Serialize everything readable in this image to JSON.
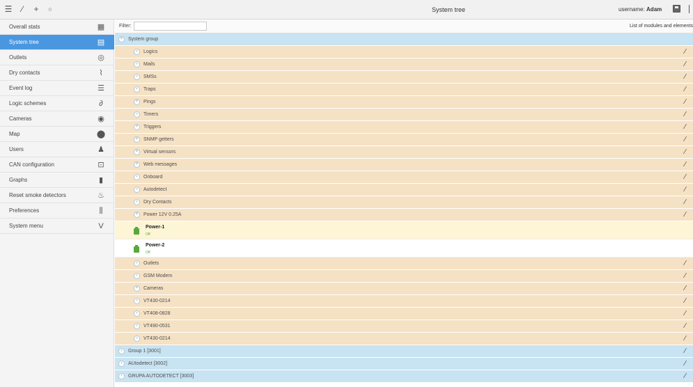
{
  "topbar": {
    "title": "System tree",
    "username_label": "username:",
    "username": "Adam",
    "icons": [
      "menu-icon",
      "wand-icon",
      "plus-icon",
      "refresh-icon",
      "save-icon"
    ]
  },
  "sidebar": {
    "items": [
      {
        "label": "Overall stats",
        "icon": "grid-icon",
        "glyph": "▦",
        "active": false
      },
      {
        "label": "System tree",
        "icon": "tree-icon",
        "glyph": "▤",
        "active": true
      },
      {
        "label": "Outlets",
        "icon": "outlet-icon",
        "glyph": "◎",
        "active": false
      },
      {
        "label": "Dry contacts",
        "icon": "switch-icon",
        "glyph": "⌇",
        "active": false
      },
      {
        "label": "Event log",
        "icon": "list-icon",
        "glyph": "☰",
        "active": false
      },
      {
        "label": "Logic schemes",
        "icon": "link-icon",
        "glyph": "∂",
        "active": false
      },
      {
        "label": "Cameras",
        "icon": "eye-icon",
        "glyph": "◉",
        "active": false
      },
      {
        "label": "Map",
        "icon": "map-pin-icon",
        "glyph": "⬤",
        "active": false
      },
      {
        "label": "Users",
        "icon": "users-icon",
        "glyph": "♟",
        "active": false
      },
      {
        "label": "CAN configuration",
        "icon": "can-icon",
        "glyph": "⊡",
        "active": false
      },
      {
        "label": "Graphs",
        "icon": "bar-chart-icon",
        "glyph": "▮",
        "active": false
      },
      {
        "label": "Reset smoke detectors",
        "icon": "flame-icon",
        "glyph": "♨",
        "active": false
      },
      {
        "label": "Preferences",
        "icon": "sliders-icon",
        "glyph": "⫼",
        "active": false
      },
      {
        "label": "System menu",
        "icon": "v-icon",
        "glyph": "V",
        "active": false
      }
    ]
  },
  "filter": {
    "label": "Filter:",
    "value": "",
    "list_label": "List of modules and elements"
  },
  "tree": {
    "rows": [
      {
        "kind": "group",
        "label": "System group",
        "toggle": "v",
        "color": "blue",
        "indent": 1,
        "edit": false
      },
      {
        "kind": "group",
        "label": "Logics",
        "toggle": ">",
        "color": "tan",
        "indent": 2,
        "edit": true
      },
      {
        "kind": "group",
        "label": "Mails",
        "toggle": ">",
        "color": "tan",
        "indent": 2,
        "edit": true
      },
      {
        "kind": "group",
        "label": "SMSs",
        "toggle": ">",
        "color": "tan",
        "indent": 2,
        "edit": true
      },
      {
        "kind": "group",
        "label": "Traps",
        "toggle": ">",
        "color": "tan",
        "indent": 2,
        "edit": true
      },
      {
        "kind": "group",
        "label": "Pings",
        "toggle": "v",
        "color": "tan",
        "indent": 2,
        "edit": true
      },
      {
        "kind": "group",
        "label": "Timers",
        "toggle": ">",
        "color": "tan",
        "indent": 2,
        "edit": true
      },
      {
        "kind": "group",
        "label": "Triggers",
        "toggle": "v",
        "color": "tan",
        "indent": 2,
        "edit": true
      },
      {
        "kind": "group",
        "label": "SNMP getters",
        "toggle": "v",
        "color": "tan",
        "indent": 2,
        "edit": true
      },
      {
        "kind": "group",
        "label": "Virtual sensors",
        "toggle": "v",
        "color": "tan",
        "indent": 2,
        "edit": true
      },
      {
        "kind": "group",
        "label": "Web messages",
        "toggle": "v",
        "color": "tan",
        "indent": 2,
        "edit": true
      },
      {
        "kind": "group",
        "label": "Onboard",
        "toggle": ">",
        "color": "tan",
        "indent": 2,
        "edit": true
      },
      {
        "kind": "group",
        "label": "Autodetect",
        "toggle": ">",
        "color": "tan",
        "indent": 2,
        "edit": true
      },
      {
        "kind": "group",
        "label": "Dry Contacts",
        "toggle": ">",
        "color": "tan",
        "indent": 2,
        "edit": true
      },
      {
        "kind": "group",
        "label": "Power 12V 0.25A",
        "toggle": "v",
        "color": "tan",
        "indent": 2,
        "edit": true
      },
      {
        "kind": "element",
        "label": "Power-1",
        "state": "Off",
        "color": "yellow"
      },
      {
        "kind": "element",
        "label": "Power-2",
        "state": "Off",
        "color": "white"
      },
      {
        "kind": "group",
        "label": "Outlets",
        "toggle": ">",
        "color": "tan",
        "indent": 2,
        "edit": true
      },
      {
        "kind": "group",
        "label": "GSM Modem",
        "toggle": ">",
        "color": "tan",
        "indent": 2,
        "edit": true
      },
      {
        "kind": "group",
        "label": "Cameras",
        "toggle": "v",
        "color": "tan",
        "indent": 2,
        "edit": true
      },
      {
        "kind": "group",
        "label": "VT430-0214",
        "toggle": ">",
        "color": "tan",
        "indent": 2,
        "edit": true
      },
      {
        "kind": "group",
        "label": "VT408-0828",
        "toggle": ">",
        "color": "tan",
        "indent": 2,
        "edit": true
      },
      {
        "kind": "group",
        "label": "VT490-0531",
        "toggle": ">",
        "color": "tan",
        "indent": 2,
        "edit": true
      },
      {
        "kind": "group",
        "label": "VT430-0214",
        "toggle": ">",
        "color": "tan",
        "indent": 2,
        "edit": true
      },
      {
        "kind": "group",
        "label": "Group 1 [3001]",
        "toggle": ">",
        "color": "blue",
        "indent": 1,
        "edit": true
      },
      {
        "kind": "group",
        "label": "AUtodetect [3002]",
        "toggle": ">",
        "color": "blue",
        "indent": 1,
        "edit": true
      },
      {
        "kind": "group",
        "label": "GRUPA AUTODETECT [3003]",
        "toggle": ">",
        "color": "blue",
        "indent": 1,
        "edit": true
      }
    ]
  },
  "colors": {
    "active": "#4a97e0",
    "group_blue": "#c8e3f1",
    "group_tan": "#f5e1c4",
    "element_selected": "#fdf5d6",
    "state_green": "#5aa83c"
  }
}
